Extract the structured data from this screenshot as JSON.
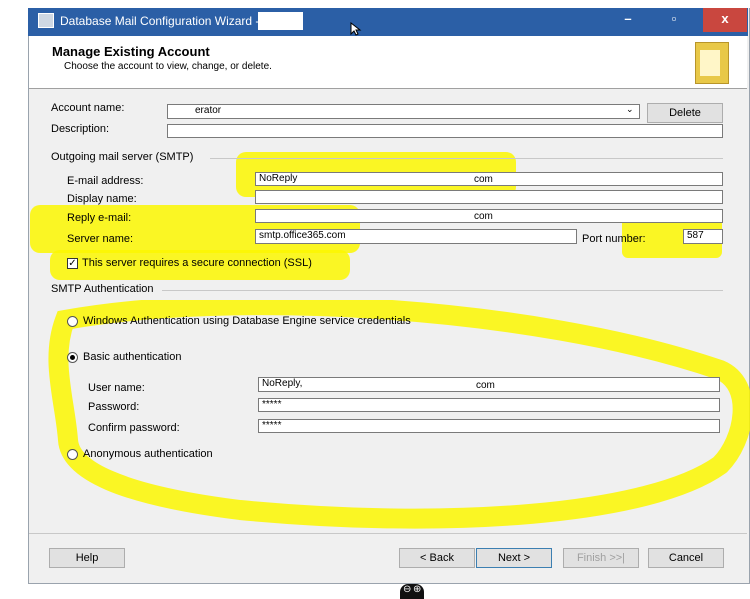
{
  "window": {
    "title": "Database Mail Configuration Wizard -",
    "min_label": "–",
    "max_label": "▫",
    "close_label": "x"
  },
  "header": {
    "title": "Manage Existing Account",
    "subtitle": "Choose the account to view, change, or delete."
  },
  "account": {
    "name_label": "Account name:",
    "name_value": "erator",
    "delete_label": "Delete",
    "description_label": "Description:",
    "description_value": ""
  },
  "smtp": {
    "group_label": "Outgoing mail server (SMTP)",
    "email_label": "E-mail address:",
    "email_value_prefix": "NoReply",
    "email_value_suffix": "com",
    "display_label": "Display name:",
    "display_value": "",
    "reply_label": "Reply e-mail:",
    "reply_value_suffix": "com",
    "server_label": "Server name:",
    "server_value": "smtp.office365.com",
    "port_label": "Port number:",
    "port_value": "587",
    "ssl_label": "This server requires a secure connection (SSL)",
    "ssl_checked": true
  },
  "auth": {
    "group_label": "SMTP Authentication",
    "windows_label": "Windows Authentication using Database Engine service credentials",
    "basic_label": "Basic authentication",
    "username_label": "User name:",
    "username_value_prefix": "NoReply,",
    "username_value_suffix": "com",
    "password_label": "Password:",
    "password_value": "*****",
    "confirm_label": "Confirm password:",
    "confirm_value": "*****",
    "anonymous_label": "Anonymous authentication",
    "selected": "basic"
  },
  "footer": {
    "help": "Help",
    "back": "< Back",
    "next": "Next >",
    "finish": "Finish >>|",
    "cancel": "Cancel"
  },
  "zoom": {
    "minus": "⊖",
    "plus": "⊕"
  },
  "colors": {
    "titlebar": "#2b5fa6",
    "highlight": "#fbf700",
    "close": "#c9473f"
  }
}
